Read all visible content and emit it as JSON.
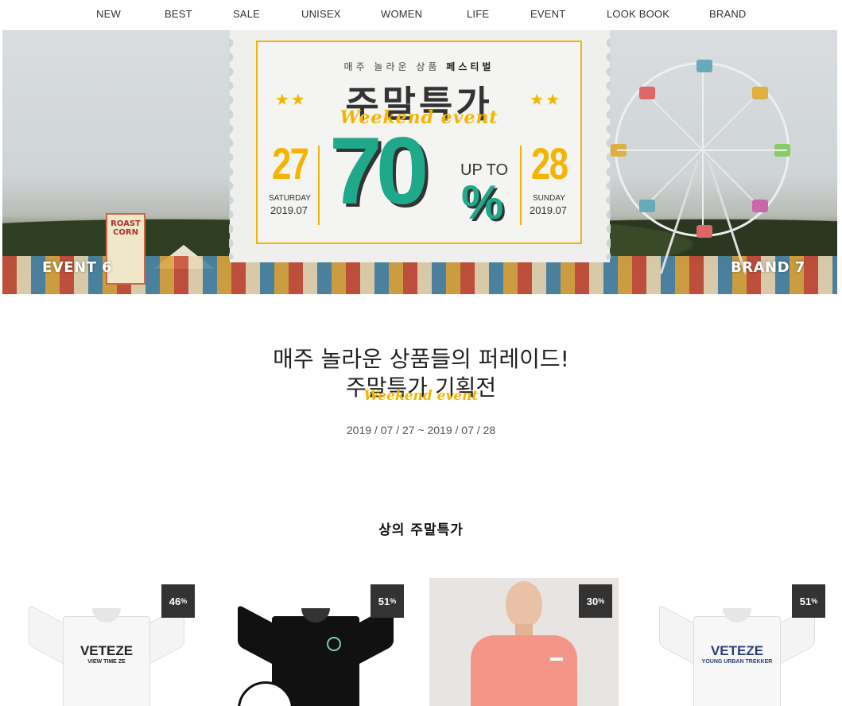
{
  "nav": {
    "items": [
      "NEW",
      "BEST",
      "SALE",
      "UNISEX",
      "WOMEN",
      "LIFE",
      "EVENT",
      "LOOK BOOK",
      "BRAND"
    ]
  },
  "banner": {
    "left_label": "EVENT 6",
    "right_label": "BRAND 7",
    "sign_text": "ROAST CORN",
    "ticket": {
      "festival_prefix": "매주 놀라운 상품",
      "festival_bold": "페스티벌",
      "title": "주말특가",
      "script": "Weekend event",
      "stars": "★★",
      "start_day": "27",
      "start_weekday": "SATURDAY",
      "start_ym": "2019.07",
      "end_day": "28",
      "end_weekday": "SUNDAY",
      "end_ym": "2019.07",
      "discount": "70",
      "discount_sign": "%",
      "up_to": "UP TO"
    }
  },
  "headline": {
    "line1": "매주 놀라운 상품들의 퍼레이드!",
    "line2": "주말특가 기획전",
    "script": "Weekend event",
    "dates": "2019 / 07 / 27 ~ 2019 / 07 / 28"
  },
  "section": {
    "title": "상의 주말특가"
  },
  "products": [
    {
      "badge": "46",
      "badge_unit": "%",
      "print": "VETEZE",
      "sub": "VIEW TIME ZE",
      "color": "#ffffff",
      "print_color": "#222222"
    },
    {
      "badge": "51",
      "badge_unit": "%",
      "print": "",
      "sub": "",
      "color": "#111111",
      "print_color": "#7fc7b3"
    },
    {
      "badge": "30",
      "badge_unit": "%",
      "print": "",
      "sub": "",
      "color": "#f4958a",
      "print_color": "#ffffff"
    },
    {
      "badge": "51",
      "badge_unit": "%",
      "print": "VETEZE",
      "sub": "YOUNG URBAN TREKKER",
      "color": "#ffffff",
      "print_color": "#2c3f7a"
    }
  ],
  "colors": {
    "accent_yellow": "#f5b400",
    "accent_green": "#1fa88a",
    "badge_bg": "#333333"
  }
}
